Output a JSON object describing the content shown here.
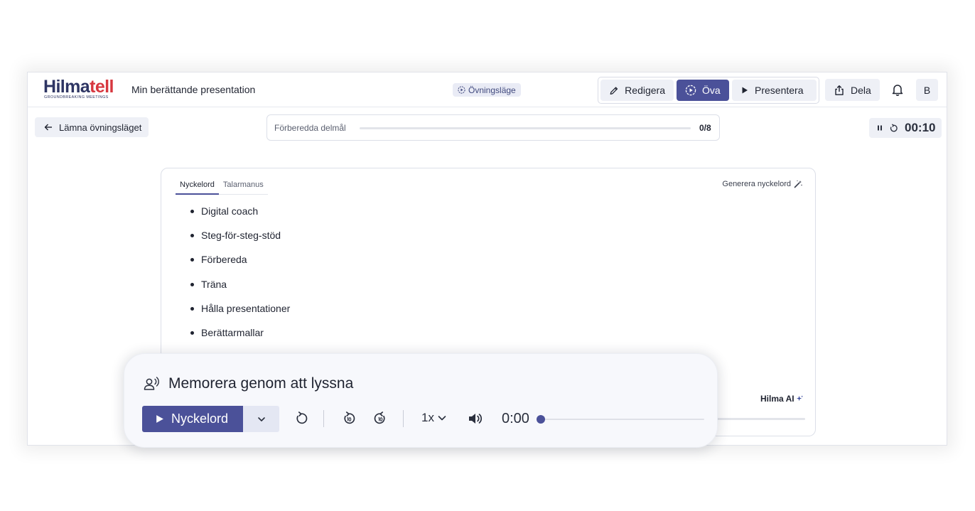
{
  "header": {
    "logo_main": "Hilma",
    "logo_accent": "tell",
    "logo_tagline": "GROUNDBREAKING MEETINGS",
    "doc_title": "Min berättande presentation",
    "mode_badge": "Övningsläge",
    "modes": [
      {
        "label": "Redigera",
        "icon": "pencil-icon",
        "active": false
      },
      {
        "label": "Öva",
        "icon": "practice-play-icon",
        "active": true
      },
      {
        "label": "Presentera",
        "icon": "play-icon",
        "active": false
      }
    ],
    "share_label": "Dela",
    "avatar_initial": "B"
  },
  "subbar": {
    "back_label": "Lämna övningsläget",
    "progress_label": "Förberedda delmål",
    "progress_value": 0,
    "progress_count": "0/8",
    "timer": "00:10"
  },
  "card": {
    "tabs": [
      {
        "label": "Nyckelord",
        "active": true
      },
      {
        "label": "Talarmanus",
        "active": false
      }
    ],
    "generate_label": "Generera nyckelord",
    "keywords": [
      "Digital coach",
      "Steg-för-steg-stöd",
      "Förbereda",
      "Träna",
      "Hålla presentationer",
      "Berättarmallar"
    ],
    "ai_label": "Hilma AI"
  },
  "player": {
    "title": "Memorera genom att lyssna",
    "play_label": "Nyckelord",
    "speed": "1x",
    "time": "0:00",
    "seek_value": 0
  },
  "colors": {
    "accent": "#4b5199",
    "logo_dark": "#2e3563",
    "logo_red": "#d7373f",
    "button_bg": "#eef0f6"
  }
}
